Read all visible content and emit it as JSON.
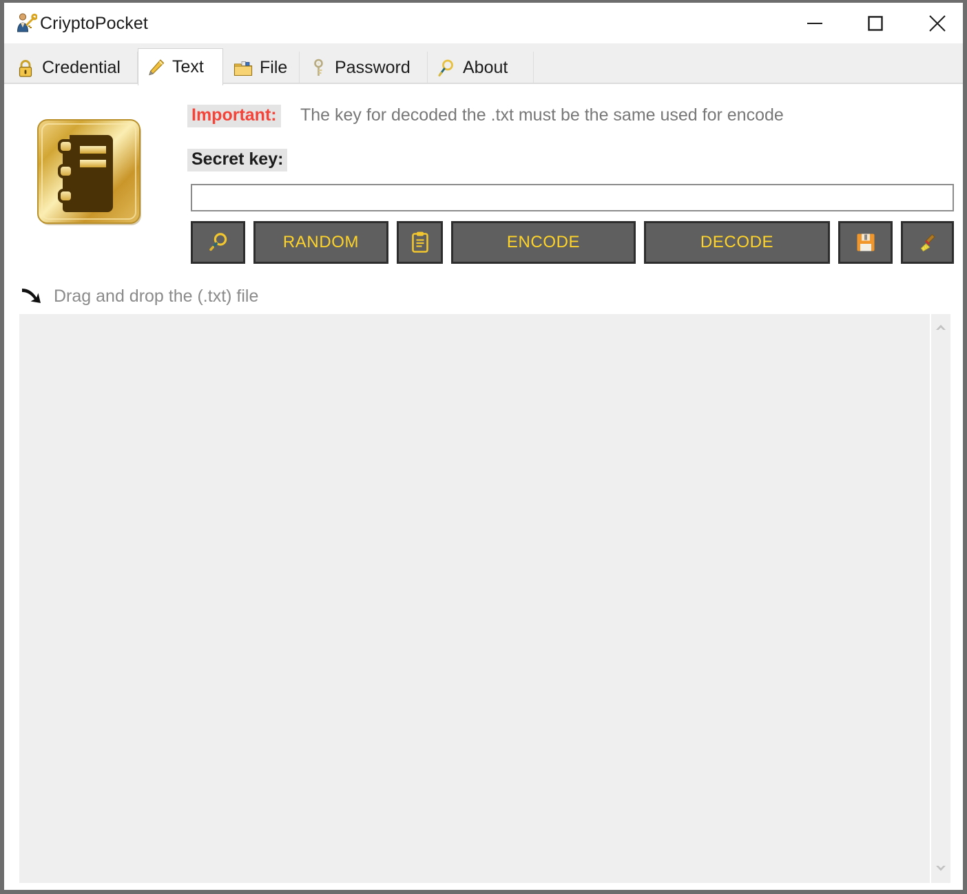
{
  "window": {
    "title": "CriyptoPocket",
    "title_icon": "user-key-icon",
    "controls": {
      "minimize": "minimize-icon",
      "maximize": "maximize-icon",
      "close": "close-icon"
    }
  },
  "tabs": [
    {
      "id": "credential",
      "label": "Credential",
      "icon": "padlock-icon",
      "active": false
    },
    {
      "id": "text",
      "label": "Text",
      "icon": "pencil-icon",
      "active": true
    },
    {
      "id": "file",
      "label": "File",
      "icon": "folder-icon",
      "active": false
    },
    {
      "id": "password",
      "label": "Password",
      "icon": "key-icon",
      "active": false
    },
    {
      "id": "about",
      "label": "About",
      "icon": "magnifier-icon",
      "active": false
    }
  ],
  "main": {
    "logo_icon": "gold-notebook-icon",
    "notice": {
      "label": "Important:",
      "text": "The key for decoded the .txt must be the same used for encode",
      "label_color": "#f4443a",
      "label_background": "#e4e4e4",
      "text_color": "#777777"
    },
    "secret_key": {
      "label": "Secret key:",
      "value": "",
      "placeholder": ""
    },
    "buttons": [
      {
        "id": "find",
        "label": "",
        "icon": "magnifier-icon",
        "type": "icon"
      },
      {
        "id": "random",
        "label": "RANDOM",
        "icon": "",
        "type": "text"
      },
      {
        "id": "clip",
        "label": "",
        "icon": "clipboard-icon",
        "type": "icon"
      },
      {
        "id": "encode",
        "label": "ENCODE",
        "icon": "",
        "type": "text"
      },
      {
        "id": "decode",
        "label": "DECODE",
        "icon": "",
        "type": "text"
      },
      {
        "id": "save",
        "label": "",
        "icon": "floppy-disk-icon",
        "type": "icon"
      },
      {
        "id": "clear",
        "label": "",
        "icon": "broom-icon",
        "type": "icon"
      }
    ],
    "button_style": {
      "background": "#5f5f5f",
      "border": "#2d2d2d",
      "text_color": "#ffd42a"
    },
    "drop_zone": {
      "icon": "arrow-down-right-icon",
      "hint": "Drag and drop the (.txt) file",
      "hint_color": "#8a8a8a",
      "content": "",
      "background": "#efefef"
    },
    "scrollbar": {
      "up": "chevron-up-icon",
      "down": "chevron-down-icon"
    }
  }
}
